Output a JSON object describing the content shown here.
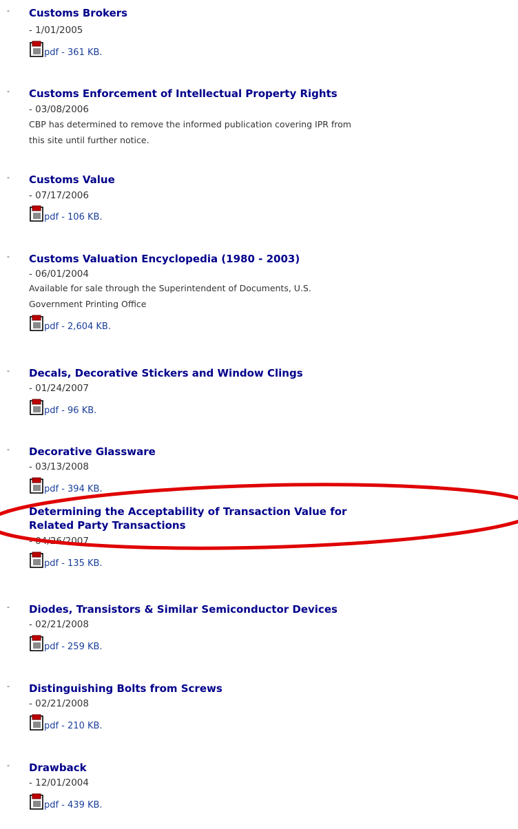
{
  "bullet_glyph": "-",
  "items": [
    {
      "title": "Customs Brokers",
      "date": "- 1/01/2005",
      "pdf_label": "pdf - 361 KB."
    },
    {
      "title": "Customs Enforcement of Intellectual Property Rights",
      "date": "- 03/08/2006",
      "description_lines": [
        "CBP has determined to remove the informed publication covering IPR from",
        "this site until further notice."
      ]
    },
    {
      "title": "Customs Value",
      "date": "- 07/17/2006",
      "pdf_label": "pdf - 106 KB."
    },
    {
      "title": "Customs Valuation Encyclopedia (1980 - 2003)",
      "date": "- 06/01/2004",
      "description_lines": [
        "Available for sale through the Superintendent of Documents, U.S.",
        "Government Printing Office"
      ],
      "pdf_label": "pdf - 2,604 KB."
    },
    {
      "title": "Decals, Decorative Stickers and Window Clings",
      "date": "- 01/24/2007",
      "pdf_label": "pdf - 96 KB."
    },
    {
      "title": "Decorative Glassware",
      "date": "- 03/13/2008",
      "pdf_label": "pdf - 394 KB."
    },
    {
      "title_lines": [
        "Determining the Acceptability of Transaction Value for",
        "Related Party Transactions"
      ],
      "date": "- 04/26/2007",
      "pdf_label": "pdf - 135 KB."
    },
    {
      "title": "Diodes, Transistors & Similar Semiconductor Devices",
      "date": "- 02/21/2008",
      "pdf_label": "pdf - 259 KB."
    },
    {
      "title": "Distinguishing Bolts from Screws",
      "date": "- 02/21/2008",
      "pdf_label": "pdf - 210 KB."
    },
    {
      "title": "Drawback",
      "date": "- 12/01/2004",
      "pdf_label": "pdf - 439 KB."
    }
  ],
  "colors": {
    "link": "#00008b",
    "text": "#333333",
    "highlight": "#e00000"
  },
  "icons": {
    "pdf": "pdf-file-icon"
  }
}
